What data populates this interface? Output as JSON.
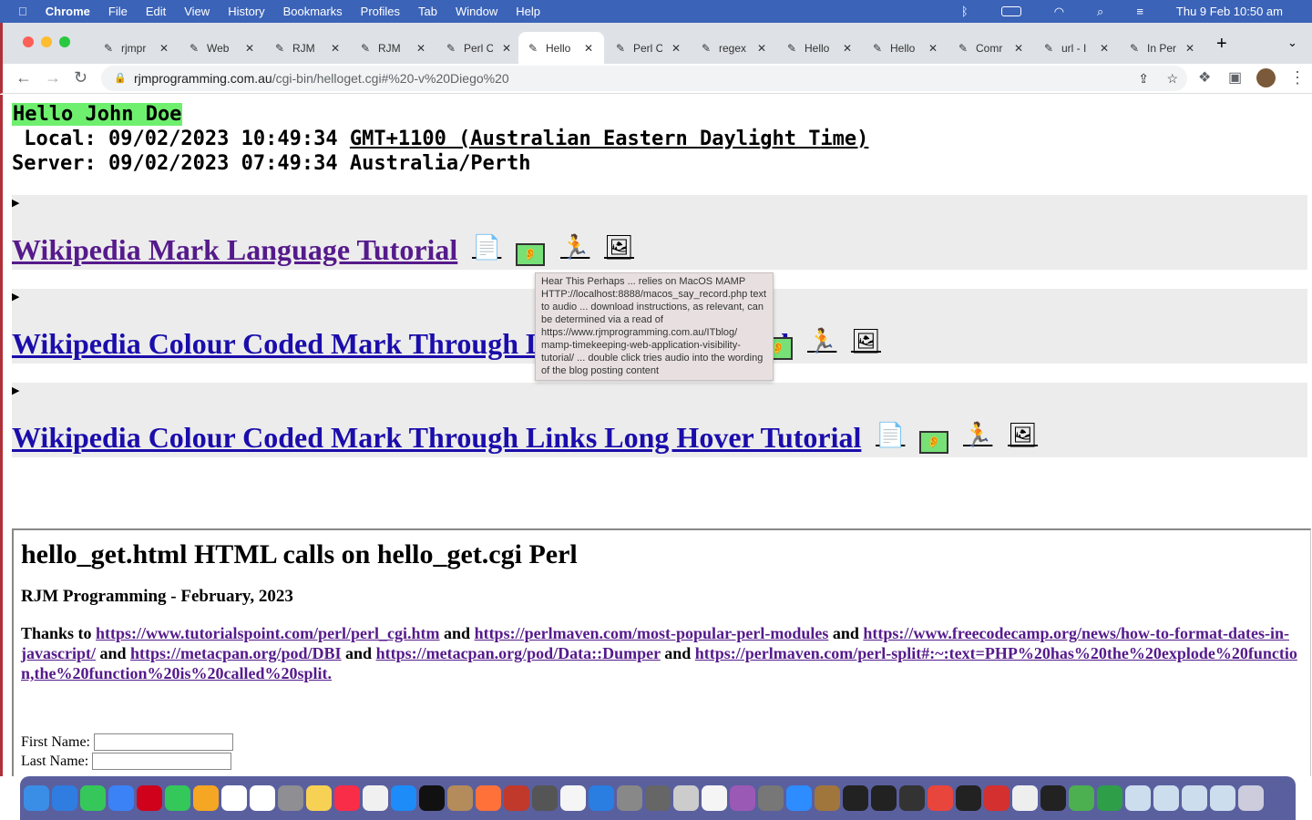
{
  "menubar": {
    "apple": "",
    "app": "Chrome",
    "items": [
      "File",
      "Edit",
      "View",
      "History",
      "Bookmarks",
      "Profiles",
      "Tab",
      "Window",
      "Help"
    ],
    "datetime": "Thu 9 Feb  10:50 am"
  },
  "tabs": [
    {
      "title": "rjmpr"
    },
    {
      "title": "Web"
    },
    {
      "title": "RJM"
    },
    {
      "title": "RJM"
    },
    {
      "title": "Perl C"
    },
    {
      "title": "Hello",
      "active": true
    },
    {
      "title": "Perl C"
    },
    {
      "title": "regex"
    },
    {
      "title": "Hello"
    },
    {
      "title": "Hello"
    },
    {
      "title": "Comr"
    },
    {
      "title": "url - I"
    },
    {
      "title": "In Per"
    }
  ],
  "address": {
    "host": "rjmprogramming.com.au",
    "path": "/cgi-bin/helloget.cgi#%20-v%20Diego%20"
  },
  "page": {
    "hello": "Hello John Doe",
    "local": " Local: 09/02/2023 10:49:34 ",
    "local_tz": "GMT+1100 (Australian Eastern Daylight Time)",
    "server": "Server: 09/02/2023 07:49:34 Australia/Perth",
    "sections": [
      {
        "link": "Wikipedia Mark Language Tutorial"
      },
      {
        "link": "Wikipedia Colour Coded Mark Through Links Hover Tutorial"
      },
      {
        "link": "Wikipedia Colour Coded Mark Through Links Long Hover Tutorial"
      }
    ],
    "tooltip": "Hear This Perhaps ... relies on MacOS MAMP HTTP://localhost:8888/macos_say_record.php text to audio ... download instructions, as relevant, can be determined via a read of https://www.rjmprogramming.com.au/ITblog/ mamp-timekeeping-web-application-visibility-tutorial/ ... double click tries audio into the wording of the blog posting content",
    "heading": "hello_get.html HTML calls on hello_get.cgi Perl",
    "subheading": "RJM Programming - February, 2023",
    "thanks": "Thanks to",
    "and": "and",
    "links": [
      "https://www.tutorialspoint.com/perl/perl_cgi.htm",
      "https://perlmaven.com/most-popular-perl-modules",
      "https://www.freecodecamp.org/news/how-to-format-dates-in-javascript/",
      "https://metacpan.org/pod/DBI",
      "https://metacpan.org/pod/Data::Dumper",
      "https://perlmaven.com/perl-split#:~:text=PHP%20has%20the%20explode%20function,the%20function%20is%20called%20split."
    ],
    "first_name_label": "First Name:",
    "last_name_label": "Last Name:",
    "first_name_value": "",
    "last_name_value": ""
  },
  "dock": [
    "finder",
    "safari",
    "messages",
    "mail",
    "opera",
    "facetime",
    "photos",
    "calendar",
    "reminders",
    "launchpad",
    "notes",
    "music",
    "news",
    "app-store",
    "apple-tv",
    "chess",
    "firefox",
    "filezilla",
    "calculator",
    "bbedit",
    "xcode",
    "system-preferences",
    "gimp",
    "preview",
    "textedit",
    "podcasts",
    "gimp2",
    "zoom",
    "archive",
    "intellij",
    "terminal",
    "quicktime",
    "chrome",
    "inkscape",
    "acrobat",
    "textedit2",
    "terminal2",
    "maps",
    "numbers",
    "folder1",
    "folder2",
    "folder3",
    "folder4",
    "trash"
  ]
}
